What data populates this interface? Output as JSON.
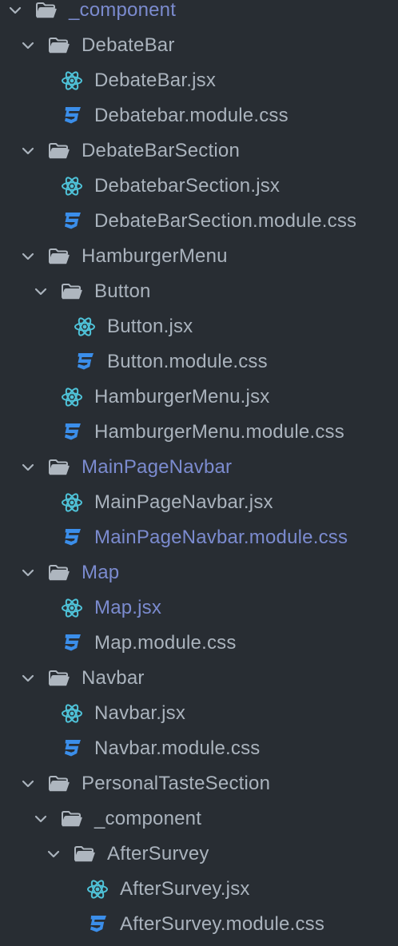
{
  "tree": {
    "rows": [
      {
        "label": "_component",
        "kind": "folder",
        "depth": 0,
        "modified": true
      },
      {
        "label": "DebateBar",
        "kind": "folder",
        "depth": 1,
        "modified": false
      },
      {
        "label": "DebateBar.jsx",
        "kind": "jsx",
        "depth": 2,
        "modified": false
      },
      {
        "label": "Debatebar.module.css",
        "kind": "css",
        "depth": 2,
        "modified": false
      },
      {
        "label": "DebateBarSection",
        "kind": "folder",
        "depth": 1,
        "modified": false
      },
      {
        "label": "DebatebarSection.jsx",
        "kind": "jsx",
        "depth": 2,
        "modified": false
      },
      {
        "label": "DebateBarSection.module.css",
        "kind": "css",
        "depth": 2,
        "modified": false
      },
      {
        "label": "HamburgerMenu",
        "kind": "folder",
        "depth": 1,
        "modified": false
      },
      {
        "label": "Button",
        "kind": "folder",
        "depth": 2,
        "modified": false
      },
      {
        "label": "Button.jsx",
        "kind": "jsx",
        "depth": 3,
        "modified": false
      },
      {
        "label": "Button.module.css",
        "kind": "css",
        "depth": 3,
        "modified": false
      },
      {
        "label": "HamburgerMenu.jsx",
        "kind": "jsx",
        "depth": 2,
        "modified": false
      },
      {
        "label": "HamburgerMenu.module.css",
        "kind": "css",
        "depth": 2,
        "modified": false
      },
      {
        "label": "MainPageNavbar",
        "kind": "folder",
        "depth": 1,
        "modified": true
      },
      {
        "label": "MainPageNavbar.jsx",
        "kind": "jsx",
        "depth": 2,
        "modified": false
      },
      {
        "label": "MainPageNavbar.module.css",
        "kind": "css",
        "depth": 2,
        "modified": true
      },
      {
        "label": "Map",
        "kind": "folder",
        "depth": 1,
        "modified": true
      },
      {
        "label": "Map.jsx",
        "kind": "jsx",
        "depth": 2,
        "modified": true
      },
      {
        "label": "Map.module.css",
        "kind": "css",
        "depth": 2,
        "modified": false
      },
      {
        "label": "Navbar",
        "kind": "folder",
        "depth": 1,
        "modified": false
      },
      {
        "label": "Navbar.jsx",
        "kind": "jsx",
        "depth": 2,
        "modified": false
      },
      {
        "label": "Navbar.module.css",
        "kind": "css",
        "depth": 2,
        "modified": false
      },
      {
        "label": "PersonalTasteSection",
        "kind": "folder",
        "depth": 1,
        "modified": false
      },
      {
        "label": "_component",
        "kind": "folder",
        "depth": 2,
        "modified": false
      },
      {
        "label": "AfterSurvey",
        "kind": "folder",
        "depth": 3,
        "modified": false
      },
      {
        "label": "AfterSurvey.jsx",
        "kind": "jsx",
        "depth": 4,
        "modified": false
      },
      {
        "label": "AfterSurvey.module.css",
        "kind": "css",
        "depth": 4,
        "modified": false
      }
    ]
  },
  "colors": {
    "background": "#282d33",
    "text": "#aab3bd",
    "modified_text": "#7b8bcf",
    "folder_icon": "#aeb6bf",
    "react_icon": "#4fc3d9",
    "css_icon": "#3b8eea",
    "chevron": "#aab3bd"
  },
  "icons": {
    "folder": "folder-open-icon",
    "jsx": "react-icon",
    "css": "css3-icon",
    "chevron": "chevron-down-icon"
  }
}
